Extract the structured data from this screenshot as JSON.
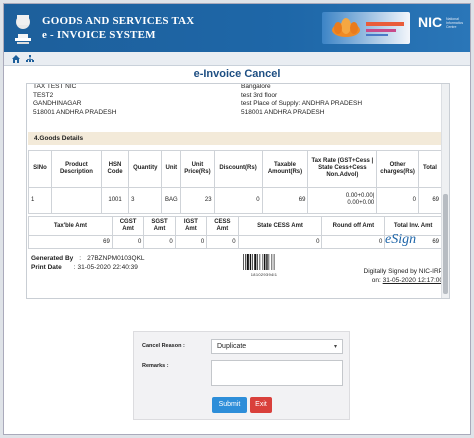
{
  "header": {
    "title_line1": "GOODS AND SERVICES TAX",
    "title_line2": "e - INVOICE SYSTEM",
    "g20_text": "",
    "nic_logo": "NIC",
    "nic_sub": "National Informatics Centre"
  },
  "nav": {
    "home_icon": "home-icon",
    "sitemap_icon": "sitemap-icon"
  },
  "page_title": "e-Invoice Cancel",
  "address": {
    "left_lines": [
      "TAX TEST NIC",
      "TEST2",
      "GANDHINAGAR",
      "518001    ANDHRA PRADESH"
    ],
    "right_lines": [
      "Bangalore",
      "test    3rd floor",
      "test Place of Supply: ANDHRA PRADESH",
      "518001    ANDHRA PRADESH"
    ]
  },
  "goods_section_title": "4.Goods Details",
  "goods_table": {
    "headers": [
      "SlNo",
      "Product Description",
      "HSN Code",
      "Quantity",
      "Unit",
      "Unit Price(Rs)",
      "Discount(Rs)",
      "Taxable Amount(Rs)",
      "Tax Rate (GST+Cess | State Cess+Cess Non.Advol)",
      "Other charges(Rs)",
      "Total"
    ],
    "row": [
      "1",
      "",
      "1001",
      "3",
      "BAG",
      "23",
      "0",
      "69",
      "0.00+0.00|\n0.00+0.00",
      "0",
      "69"
    ]
  },
  "totals_table": {
    "headers": [
      "Tax'ble Amt",
      "CGST Amt",
      "SGST Amt",
      "IGST Amt",
      "CESS Amt",
      "State CESS Amt",
      "Round off Amt",
      "Total Inv. Amt"
    ],
    "values": [
      "69",
      "0",
      "0",
      "0",
      "0",
      "0",
      "0",
      "69"
    ]
  },
  "footer": {
    "generated_label": "Generated By",
    "generated_value": "27BZNPM0103QKL",
    "print_label": "Print Date",
    "print_value": "31-05-2020 22:40:39",
    "barcode_number": "181029394l1",
    "esign_logo": "eSign",
    "signed_by": "Digitally Signed by NIC-IRP",
    "signed_on_label": "on:",
    "signed_on_value": "31-05-2020 12:17:00"
  },
  "form": {
    "cancel_reason_label": "Cancel Reason :",
    "cancel_reason_value": "Duplicate",
    "remarks_label": "Remarks :",
    "remarks_value": "",
    "submit_label": "Submit",
    "exit_label": "Exit"
  },
  "colors": {
    "header_blue": "#1d5f9b",
    "submit": "#2d8ed9",
    "exit": "#d9403b",
    "section_bg": "#f3ead9"
  }
}
